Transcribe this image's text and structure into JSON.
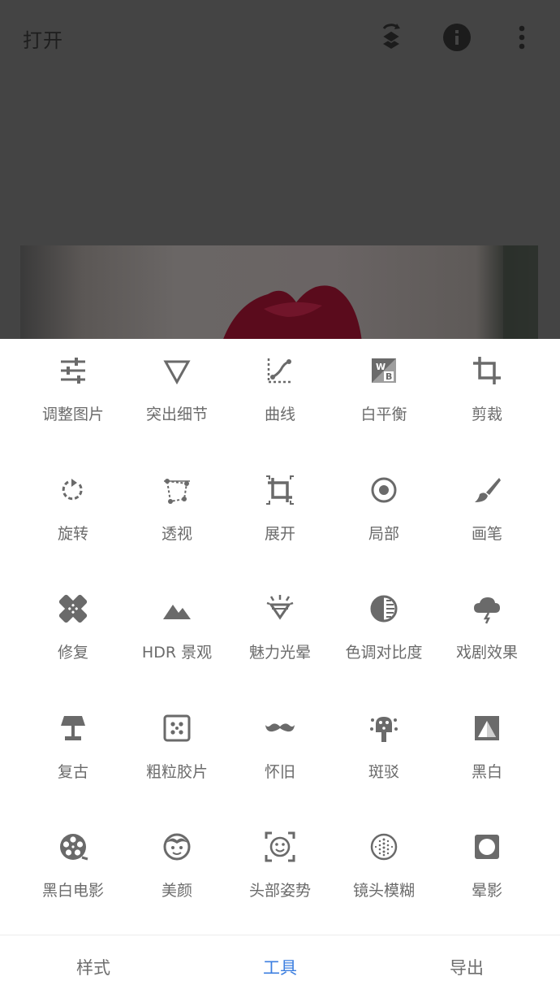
{
  "header": {
    "open_label": "打开",
    "icons": [
      "layers-swap-icon",
      "info-icon",
      "more-vert-icon"
    ]
  },
  "tools": [
    {
      "label": "调整图片",
      "icon": "tune-icon"
    },
    {
      "label": "突出细节",
      "icon": "details-triangle-icon"
    },
    {
      "label": "曲线",
      "icon": "curves-icon"
    },
    {
      "label": "白平衡",
      "icon": "white-balance-icon"
    },
    {
      "label": "剪裁",
      "icon": "crop-icon"
    },
    {
      "label": "旋转",
      "icon": "rotate-icon"
    },
    {
      "label": "透视",
      "icon": "perspective-icon"
    },
    {
      "label": "展开",
      "icon": "expand-icon"
    },
    {
      "label": "局部",
      "icon": "selective-icon"
    },
    {
      "label": "画笔",
      "icon": "brush-icon"
    },
    {
      "label": "修复",
      "icon": "healing-icon"
    },
    {
      "label": "HDR 景观",
      "icon": "hdr-mountains-icon"
    },
    {
      "label": "魅力光晕",
      "icon": "glamour-glow-icon"
    },
    {
      "label": "色调对比度",
      "icon": "tonal-contrast-icon"
    },
    {
      "label": "戏剧效果",
      "icon": "drama-cloud-icon"
    },
    {
      "label": "复古",
      "icon": "vintage-lamp-icon"
    },
    {
      "label": "粗粒胶片",
      "icon": "grainy-film-icon"
    },
    {
      "label": "怀旧",
      "icon": "retrolux-mustache-icon"
    },
    {
      "label": "斑驳",
      "icon": "grunge-icon"
    },
    {
      "label": "黑白",
      "icon": "black-white-icon"
    },
    {
      "label": "黑白电影",
      "icon": "noir-film-reel-icon"
    },
    {
      "label": "美颜",
      "icon": "face-enhance-icon"
    },
    {
      "label": "头部姿势",
      "icon": "head-pose-icon"
    },
    {
      "label": "镜头模糊",
      "icon": "lens-blur-icon"
    },
    {
      "label": "晕影",
      "icon": "vignette-icon"
    }
  ],
  "bottom_tabs": [
    {
      "label": "样式"
    },
    {
      "label": "工具"
    },
    {
      "label": "导出"
    }
  ],
  "active_tab": "工具",
  "colors": {
    "accent": "#3d7fe0",
    "icon": "#6a6a6a",
    "overlay": "#444444"
  }
}
